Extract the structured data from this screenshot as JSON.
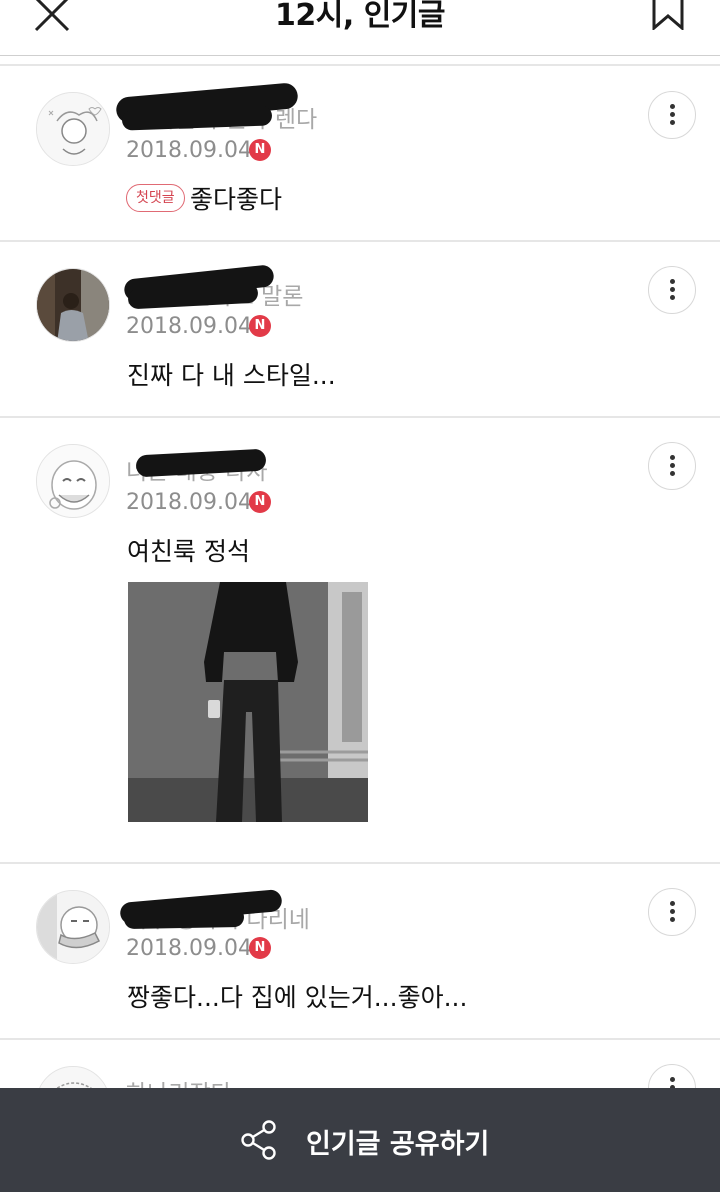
{
  "header": {
    "title": "12시, 인기글"
  },
  "comments": [
    {
      "nickname": "내 가슴이 뛴다 렌다",
      "date": "2018.09.04",
      "badge": "N",
      "first_label": "첫댓글",
      "text": "좋다좋다"
    },
    {
      "nickname": "9월에 만나요 말론",
      "date": "2018.09.04",
      "badge": "N",
      "text": "진짜 다 내 스타일..."
    },
    {
      "nickname": "너는 대충 타자",
      "date": "2018.09.04",
      "badge": "N",
      "text": "여친룩 정석"
    },
    {
      "nickname": "너무 좋아서 다리네",
      "date": "2018.09.04",
      "badge": "N",
      "text": "짱좋다...다 집에 있는거...좋아..."
    },
    {
      "nickname": "하나리장다"
    }
  ],
  "bottom_bar": {
    "label": "인기글 공유하기"
  },
  "colors": {
    "badge_red": "#e23a48",
    "bottom_bar_bg": "#3a3d44"
  }
}
